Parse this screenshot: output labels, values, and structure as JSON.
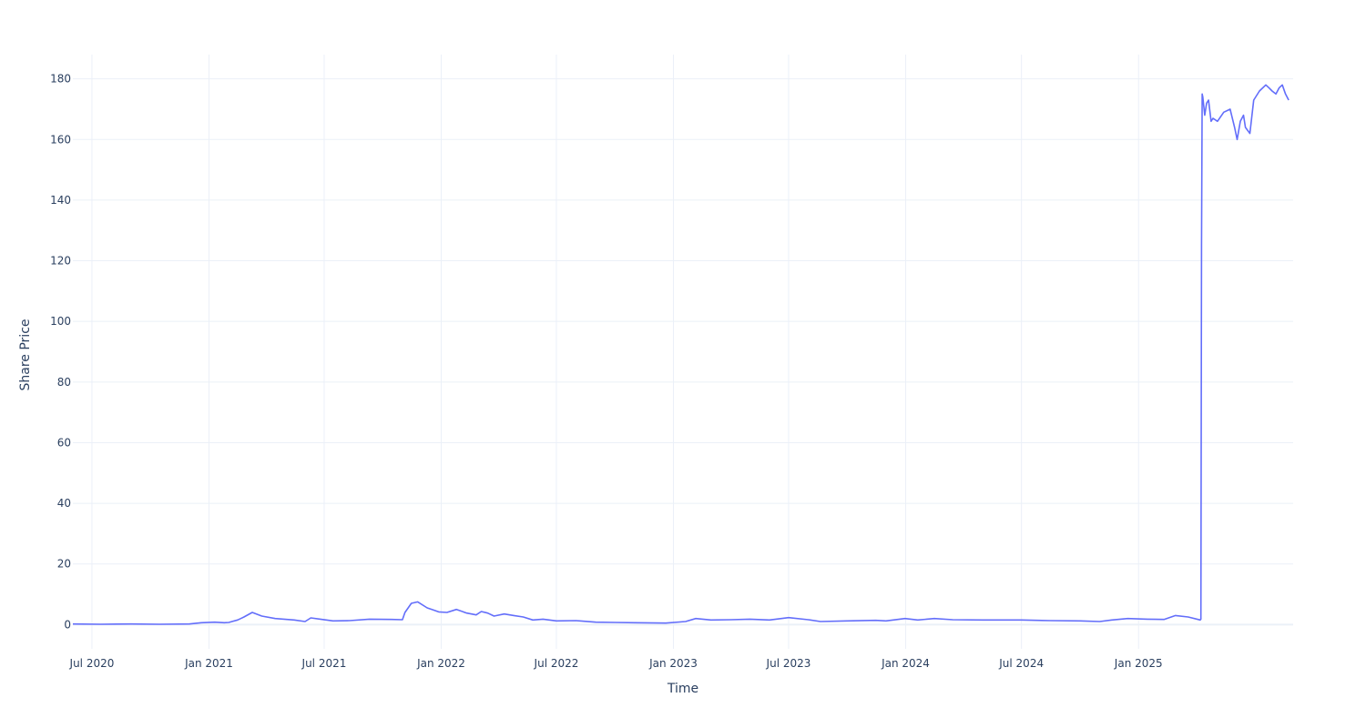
{
  "chart_data": {
    "type": "line",
    "title": "",
    "xlabel": "Time",
    "ylabel": "Share Price",
    "xlim": [
      "2020-06-01",
      "2025-09-01"
    ],
    "ylim": [
      -8,
      188
    ],
    "x_ticks": [
      {
        "date": "2020-07-01",
        "label": "Jul 2020"
      },
      {
        "date": "2021-01-01",
        "label": "Jan 2021"
      },
      {
        "date": "2021-07-01",
        "label": "Jul 2021"
      },
      {
        "date": "2022-01-01",
        "label": "Jan 2022"
      },
      {
        "date": "2022-07-01",
        "label": "Jul 2022"
      },
      {
        "date": "2023-01-01",
        "label": "Jan 2023"
      },
      {
        "date": "2023-07-01",
        "label": "Jul 2023"
      },
      {
        "date": "2024-01-01",
        "label": "Jan 2024"
      },
      {
        "date": "2024-07-01",
        "label": "Jul 2024"
      },
      {
        "date": "2025-01-01",
        "label": "Jan 2025"
      }
    ],
    "y_ticks": [
      {
        "value": 0,
        "label": "0"
      },
      {
        "value": 20,
        "label": "20"
      },
      {
        "value": 40,
        "label": "40"
      },
      {
        "value": 60,
        "label": "60"
      },
      {
        "value": 80,
        "label": "80"
      },
      {
        "value": 100,
        "label": "100"
      },
      {
        "value": 120,
        "label": "120"
      },
      {
        "value": 140,
        "label": "140"
      },
      {
        "value": 160,
        "label": "160"
      },
      {
        "value": 180,
        "label": "180"
      }
    ],
    "grid": true,
    "legend": "none",
    "colors": {
      "line": "#636efa",
      "grid": "#ebf0f8",
      "text": "#2a3f5f"
    },
    "series": [
      {
        "x": [
          "2020-06-01",
          "2020-07-15",
          "2020-09-01",
          "2020-10-15",
          "2020-12-01",
          "2020-12-20",
          "2021-01-10",
          "2021-01-25",
          "2021-02-01",
          "2021-02-15",
          "2021-02-20",
          "2021-02-25",
          "2021-03-10",
          "2021-03-25",
          "2021-04-15",
          "2021-05-15",
          "2021-06-01",
          "2021-06-10",
          "2021-06-25",
          "2021-07-15",
          "2021-08-10",
          "2021-09-10",
          "2021-10-15",
          "2021-11-01",
          "2021-11-05",
          "2021-11-15",
          "2021-11-25",
          "2021-12-10",
          "2021-12-20",
          "2021-12-28",
          "2022-01-10",
          "2022-01-25",
          "2022-02-10",
          "2022-02-25",
          "2022-03-05",
          "2022-03-15",
          "2022-03-25",
          "2022-04-10",
          "2022-04-25",
          "2022-05-10",
          "2022-05-25",
          "2022-06-10",
          "2022-07-01",
          "2022-08-01",
          "2022-09-01",
          "2022-10-01",
          "2022-11-01",
          "2022-12-20",
          "2023-01-20",
          "2023-02-05",
          "2023-03-01",
          "2023-04-01",
          "2023-05-01",
          "2023-06-01",
          "2023-07-01",
          "2023-08-01",
          "2023-08-20",
          "2023-10-01",
          "2023-11-15",
          "2023-12-01",
          "2023-12-31",
          "2024-01-20",
          "2024-02-15",
          "2024-03-15",
          "2024-05-01",
          "2024-07-01",
          "2024-08-15",
          "2024-10-01",
          "2024-11-01",
          "2024-11-20",
          "2024-12-15",
          "2025-01-15",
          "2025-02-10",
          "2025-02-28",
          "2025-03-20",
          "2025-04-08",
          "2025-04-09",
          "2025-04-10",
          "2025-04-11",
          "2025-04-12",
          "2025-04-15",
          "2025-04-18",
          "2025-04-21",
          "2025-04-25",
          "2025-04-28",
          "2025-05-05",
          "2025-05-15",
          "2025-05-25",
          "2025-06-01",
          "2025-06-05",
          "2025-06-10",
          "2025-06-15",
          "2025-06-18",
          "2025-06-25",
          "2025-07-01",
          "2025-07-10",
          "2025-07-20",
          "2025-07-25",
          "2025-07-30",
          "2025-08-05",
          "2025-08-10",
          "2025-08-15",
          "2025-08-20",
          "2025-08-25"
        ],
        "y": [
          0.2,
          0.1,
          0.2,
          0.1,
          0.2,
          0.6,
          0.8,
          0.6,
          0.7,
          1.5,
          2.0,
          2.5,
          4.0,
          2.8,
          2.0,
          1.5,
          1.0,
          2.2,
          1.8,
          1.2,
          1.3,
          1.8,
          1.7,
          1.6,
          4.0,
          7.0,
          7.5,
          5.5,
          4.8,
          4.2,
          4.0,
          5.0,
          3.8,
          3.2,
          4.3,
          3.8,
          2.8,
          3.5,
          3.0,
          2.5,
          1.5,
          1.8,
          1.2,
          1.3,
          0.8,
          0.7,
          0.6,
          0.5,
          1.0,
          2.0,
          1.5,
          1.6,
          1.8,
          1.5,
          2.3,
          1.6,
          1.0,
          1.2,
          1.4,
          1.2,
          2.0,
          1.5,
          2.0,
          1.6,
          1.5,
          1.5,
          1.3,
          1.2,
          1.0,
          1.5,
          2.0,
          1.8,
          1.7,
          3.0,
          2.5,
          1.5,
          1.8,
          125,
          175,
          174,
          168,
          172,
          173,
          166,
          167,
          166,
          169,
          170,
          164,
          160,
          166,
          168,
          164,
          162,
          173,
          176,
          178,
          177,
          176,
          175,
          177,
          178,
          175,
          173
        ]
      }
    ]
  }
}
